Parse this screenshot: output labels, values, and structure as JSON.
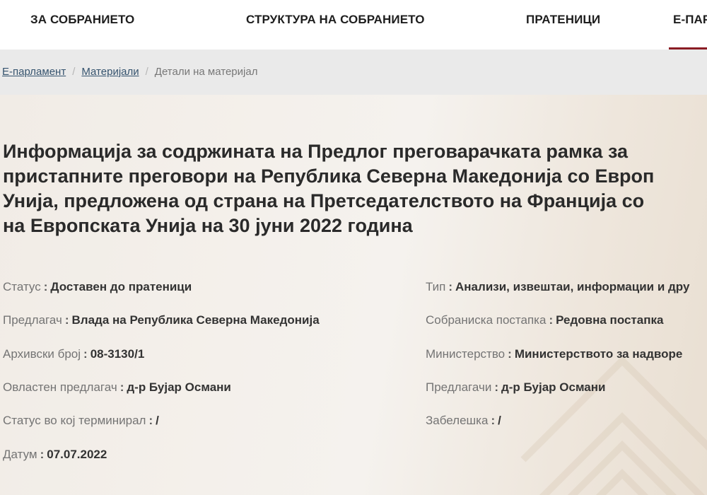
{
  "nav": {
    "items": [
      {
        "label": "ЗА СОБРАНИЕТО"
      },
      {
        "label": "СТРУКТУРА НА СОБРАНИЕТО"
      },
      {
        "label": "ПРАТЕНИЦИ"
      },
      {
        "label": "Е-ПАРЛАМЕНТ"
      }
    ],
    "active_color": "#8a1c24"
  },
  "breadcrumb": {
    "items": [
      "Е-парламент",
      "Материјали",
      "Детали на материјал"
    ],
    "separator": "/"
  },
  "material": {
    "title_lines": [
      "Информација за содржината на Предлог преговарачката рамка за",
      "пристапните преговори на Република Северна Македонија со Европ",
      "Унија, предложена од страна на Претседателството на Франција со",
      "на Европската Унија на 30 јуни 2022 година"
    ],
    "left_fields": [
      {
        "label": "Статус",
        "value": "Доставен до пратеници"
      },
      {
        "label": "Предлагач",
        "value": "Влада на Република Северна Македонија"
      },
      {
        "label": "Архивски број",
        "value": "08-3130/1"
      },
      {
        "label": "Овластен предлагач",
        "value": "д-р Бујар Османи"
      },
      {
        "label": "Статус во кој терминирал",
        "value": "/"
      },
      {
        "label": "Датум",
        "value": "07.07.2022"
      }
    ],
    "right_fields": [
      {
        "label": "Тип",
        "value": "Анализи, извештаи, информации и дру"
      },
      {
        "label": "Собраниска постапка",
        "value": "Редовна постапка"
      },
      {
        "label": "Министерство",
        "value": "Министерството за надворе"
      },
      {
        "label": "Предлагачи",
        "value": "д-р Бујар Османи"
      },
      {
        "label": "Забелешка",
        "value": "/"
      }
    ],
    "colon": ":"
  }
}
